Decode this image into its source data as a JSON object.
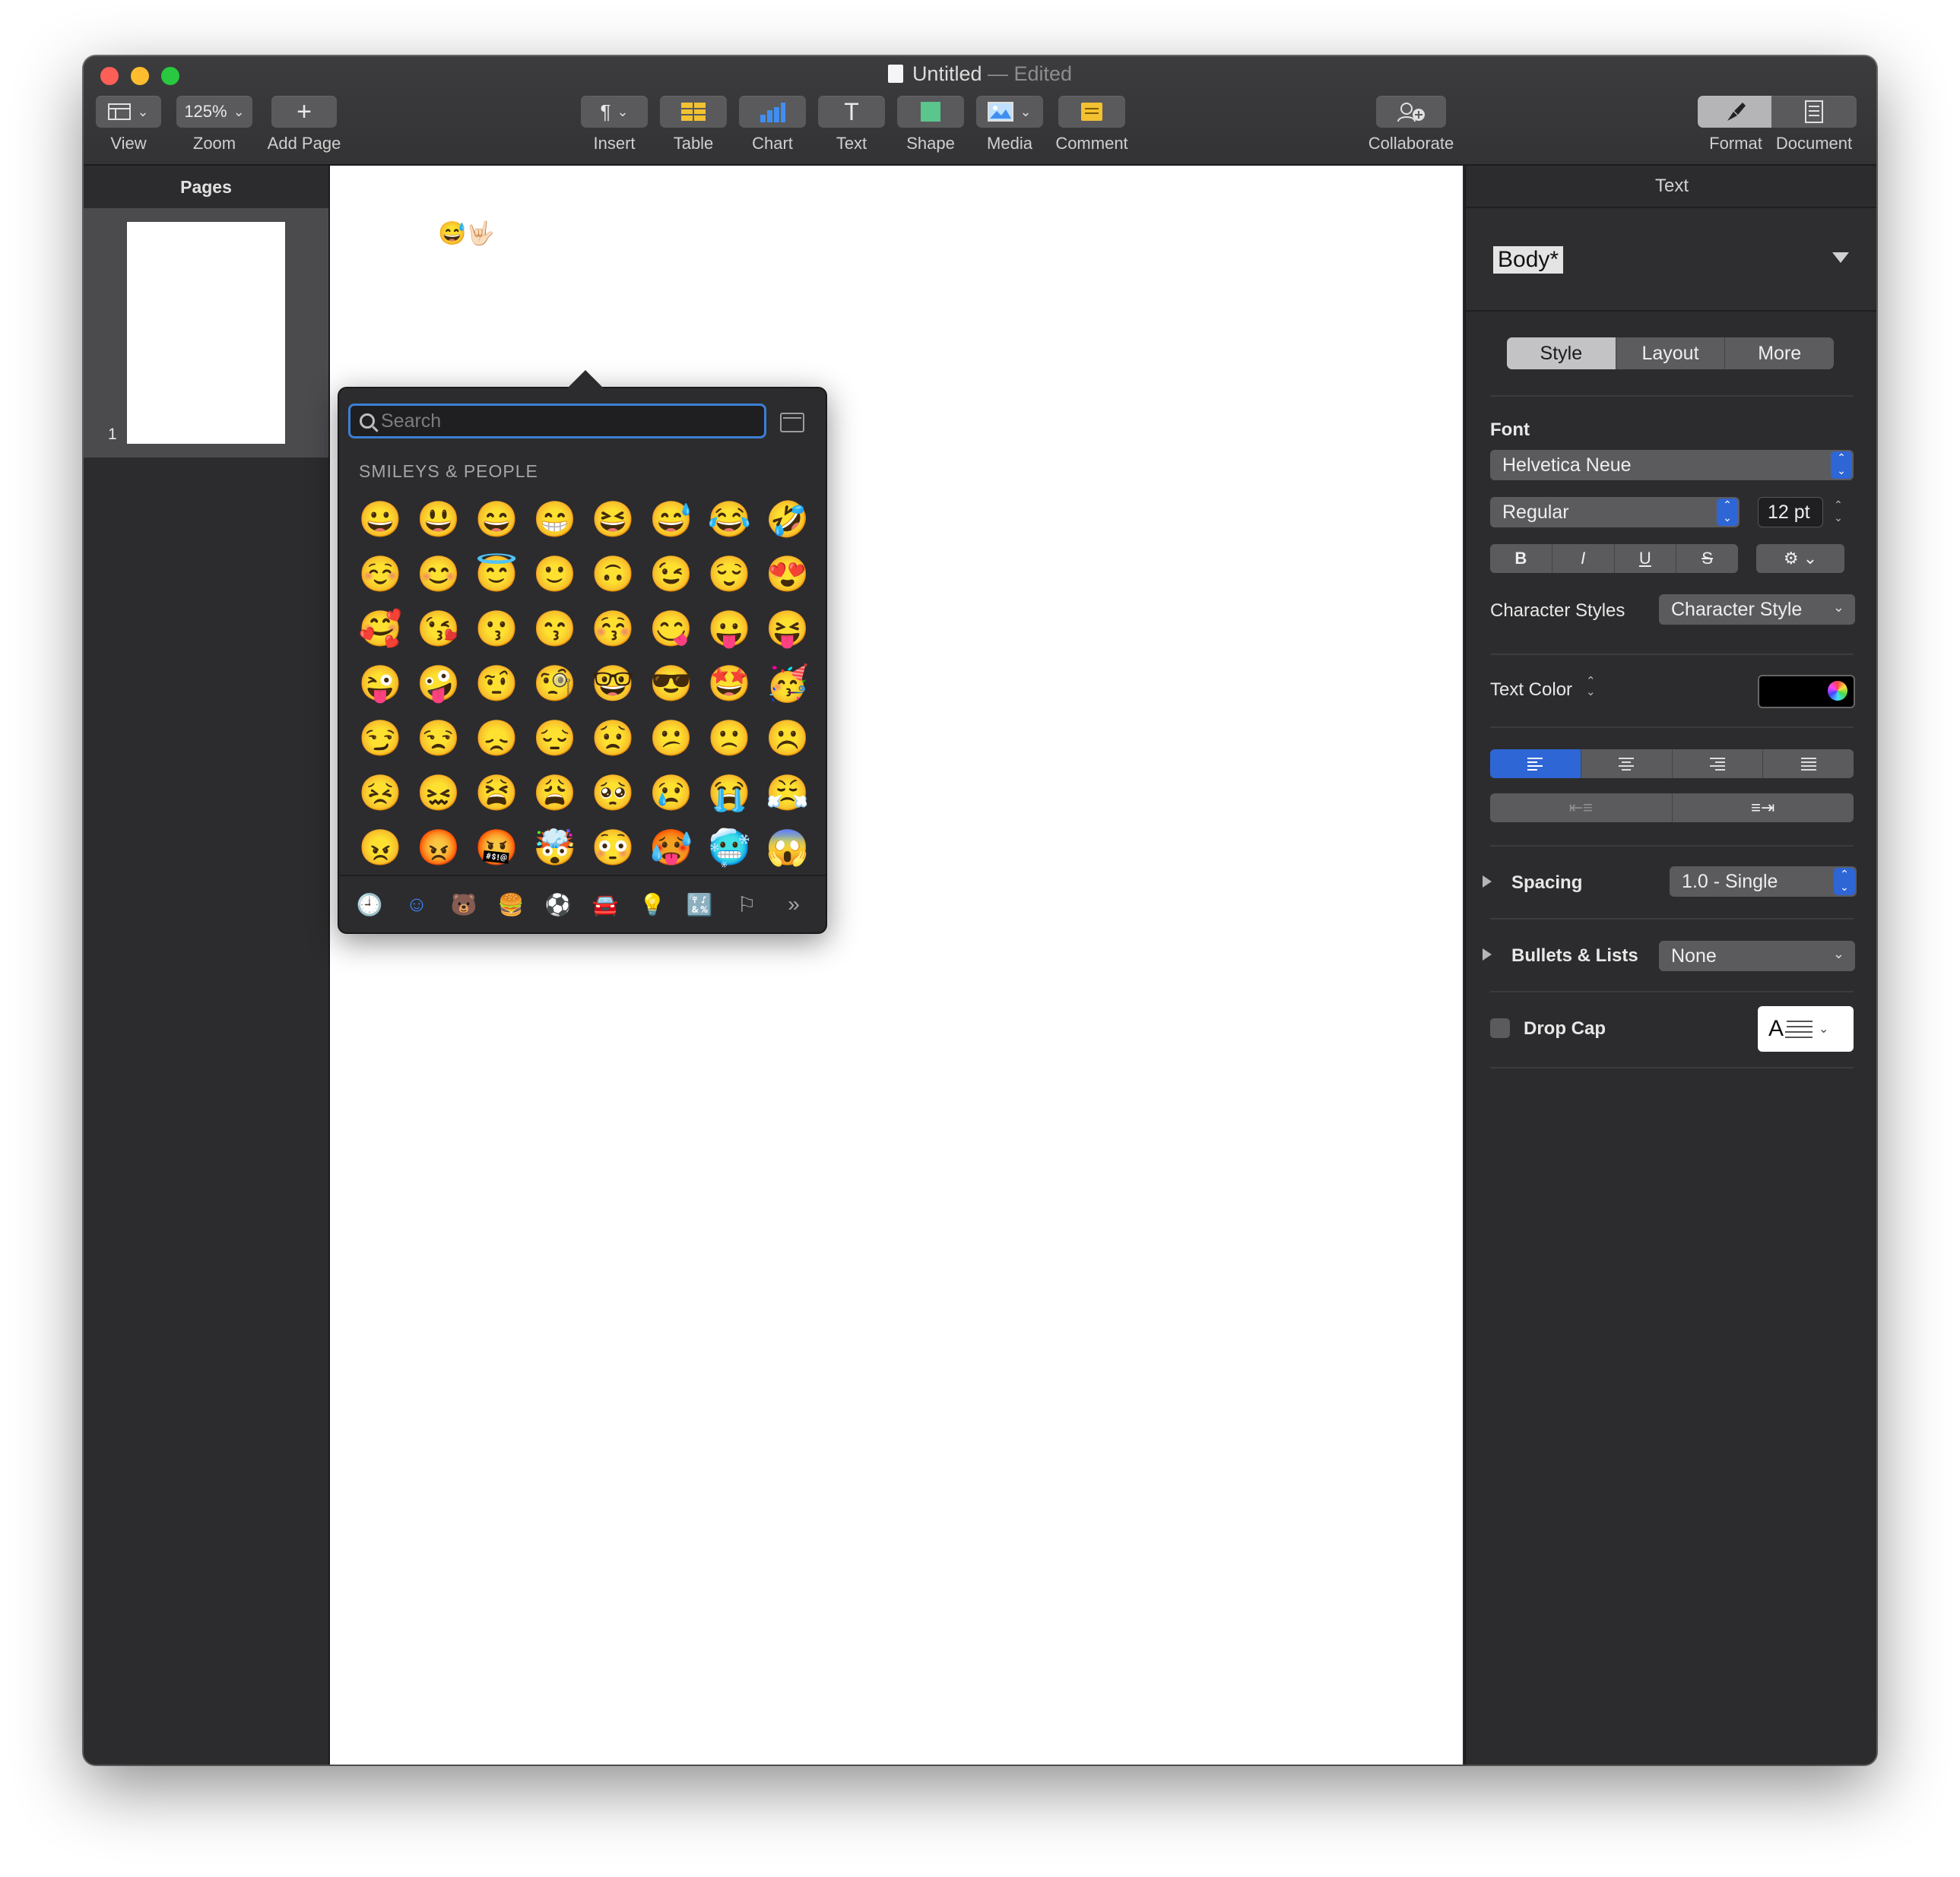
{
  "window": {
    "title": "Untitled",
    "title_suffix": "— Edited"
  },
  "toolbar": {
    "view_label": "View",
    "zoom_value": "125%",
    "zoom_label": "Zoom",
    "add_page_label": "Add Page",
    "insert_label": "Insert",
    "table_label": "Table",
    "chart_label": "Chart",
    "text_label": "Text",
    "shape_label": "Shape",
    "media_label": "Media",
    "comment_label": "Comment",
    "collaborate_label": "Collaborate",
    "format_label": "Format",
    "document_label": "Document"
  },
  "pages": {
    "header": "Pages",
    "thumbnails": [
      {
        "number": "1"
      }
    ]
  },
  "document": {
    "inserted_text": "😅🤟🏻"
  },
  "emoji_picker": {
    "search_placeholder": "Search",
    "category_title": "SMILEYS & PEOPLE",
    "emojis": [
      "😀",
      "😃",
      "😄",
      "😁",
      "😆",
      "😅",
      "😂",
      "🤣",
      "☺️",
      "😊",
      "😇",
      "🙂",
      "🙃",
      "😉",
      "😌",
      "😍",
      "🥰",
      "😘",
      "😗",
      "😙",
      "😚",
      "😋",
      "😛",
      "😝",
      "😜",
      "🤪",
      "🤨",
      "🧐",
      "🤓",
      "😎",
      "🤩",
      "🥳",
      "😏",
      "😒",
      "😞",
      "😔",
      "😟",
      "😕",
      "🙁",
      "☹️",
      "😣",
      "😖",
      "😫",
      "😩",
      "🥺",
      "😢",
      "😭",
      "😤",
      "😠",
      "😡",
      "🤬",
      "🤯",
      "😳",
      "🥵",
      "🥶",
      "😱"
    ],
    "footer_categories": [
      "🕘",
      "☺",
      "🐻",
      "🍔",
      "⚽",
      "🚘",
      "💡",
      "🔣",
      "⚐",
      "»"
    ]
  },
  "inspector": {
    "title": "Text",
    "paragraph_style": "Body*",
    "tabs": [
      "Style",
      "Layout",
      "More"
    ],
    "selected_tab": "Style",
    "font_label": "Font",
    "font_family": "Helvetica Neue",
    "font_weight": "Regular",
    "font_size": "12 pt",
    "bold_label": "B",
    "italic_label": "I",
    "underline_label": "U",
    "strike_label": "S",
    "character_styles_label": "Character Styles",
    "character_style_value": "Character Style",
    "text_color_label": "Text Color",
    "text_color": "#000000",
    "spacing_label": "Spacing",
    "spacing_value": "1.0 - Single",
    "bullets_label": "Bullets & Lists",
    "bullets_value": "None",
    "drop_cap_label": "Drop Cap",
    "drop_cap_preview": "A"
  },
  "colors": {
    "accent": "#2f66d6",
    "search_focus": "#3b7fd6"
  }
}
